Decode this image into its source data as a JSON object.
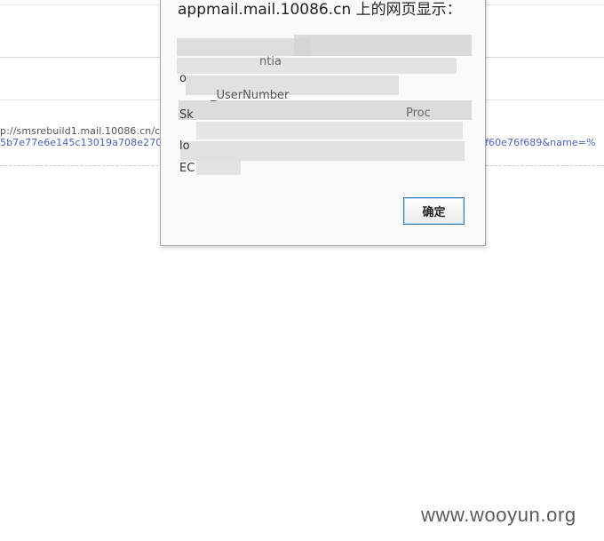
{
  "page": {
    "url_line_1": "p://smsrebuild1.mail.10086.cn/c",
    "url_line_2": "5b7e77e6e145c13019a708e2707",
    "url_line_3": "f60e76f689&name=%"
  },
  "dialog": {
    "title": "appmail.mail.10086.cn 上的网页显示：",
    "message_lines": [
      "",
      "ntia",
      "o",
      "_UserNumber",
      "Sk",
      "Proc",
      "lo",
      "EC"
    ],
    "ok_label": "确定"
  },
  "watermark": "www.wooyun.org",
  "colors": {
    "link": "#4a5fc1",
    "dialog_bg": "#fafafa",
    "button_border": "#3c7fb1",
    "pixelation": "#d4d4d4"
  }
}
